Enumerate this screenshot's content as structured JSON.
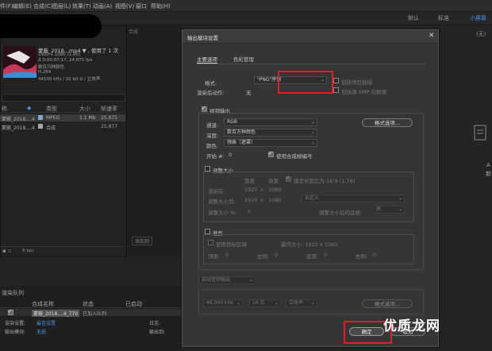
{
  "menu": [
    "件(F)",
    "编辑(E)",
    "合成(C)",
    "图层(L)",
    "效果(T)",
    "动画(A)",
    "视图(V)",
    "窗口",
    "帮助(H)"
  ],
  "workspaces": {
    "default": "默认",
    "standard": "标准",
    "small_screen": "小屏幕"
  },
  "project": {
    "filename": "蒙蔽_2018...mp4 ▼ , 使用了 1 次",
    "size": "1920 x 1080 (1.00)",
    "duration": "Δ 0:00:07:17, 24.875 fps",
    "colors": "数百万种颜色",
    "codec": "H.264",
    "audio": "44100 kHz / 32 bit U / 立体声"
  },
  "project_headers": {
    "name": "称",
    "type": "类型",
    "size": "大小",
    "fps": "帧速率"
  },
  "project_rows": [
    {
      "name": "蒙蔽_2018....4",
      "type": "MPEG",
      "size": "1.1 Mb",
      "fps": "25.875",
      "color": "#8aa6c8"
    },
    {
      "name": "蒙蔽_2018....4",
      "type": "合成",
      "size": "",
      "fps": "25.877",
      "color": "#a8a8a8"
    }
  ],
  "project_bits": "8 bpc",
  "viewer_label": "合成",
  "viewer_label2": "添加到",
  "right_panel": {
    "label1": "(无)",
    "label2": "A",
    "label3": "新"
  },
  "dialog": {
    "title": "输出模块设置",
    "tabs": {
      "main": "主要选项",
      "color": "色彩管理"
    },
    "format_label": "格式:",
    "format_value": "\"PNG\"序列",
    "post_render_label": "渲染后动作:",
    "post_render_value": "无",
    "include_project_link": "包括项目链接",
    "include_xmp": "包括源 XMP 元数据",
    "video_output": "视频输出",
    "channels_label": "通道:",
    "channels_value": "RGB",
    "depth_label": "深度:",
    "depth_value": "数百万种颜色",
    "color_label": "颜色:",
    "color_value": "预乘（遮罩）",
    "start_label": "开始 #:",
    "start_value": "0",
    "use_comp_frame": "使用合成帧编号",
    "format_options": "格式选项...",
    "resize": "调整大小",
    "width": "宽度",
    "height": "高度",
    "lock_aspect": "锁定长宽比为 16:9 (1.78)",
    "render_at": "渲染在:",
    "render_w": "1920",
    "render_h": "1080",
    "resize_to": "调整大小到:",
    "resize_w": "1920",
    "resize_h": "1080",
    "custom": "自定义",
    "resize_pct": "调整大小 %:",
    "resize_quality": "调整大小后的品质:",
    "quality_value": "高",
    "crop": "裁剪",
    "use_roi": "使用目标区域",
    "final_size": "最终大小: 1920 x 1080",
    "top": "顶部:",
    "top_v": "0",
    "left": "左侧:",
    "left_v": "0",
    "bottom": "底部:",
    "bottom_v": "0",
    "right": "右侧:",
    "right_v": "0",
    "audio_auto": "自动音频输出",
    "audio_rate": "48.000 kHz",
    "audio_bits": "16 位",
    "audio_ch": "立体声",
    "audio_format": "格式选项...",
    "ok": "确定",
    "cancel": "取消"
  },
  "render_queue": {
    "title": "渲染队列",
    "headers": {
      "comp": "合成名称",
      "status": "状态",
      "started": "已启动"
    },
    "row_name": "蒙蔽_2018....4_770",
    "row_status": "已加入队列",
    "settings_label": "渲染设置:",
    "settings_value": "最佳设置",
    "output_label": "输出模块:",
    "output_value": "无损",
    "log_label": "日志:",
    "log_value": "仅错误",
    "output_to": "输出到:"
  },
  "watermark": "优质龙网"
}
